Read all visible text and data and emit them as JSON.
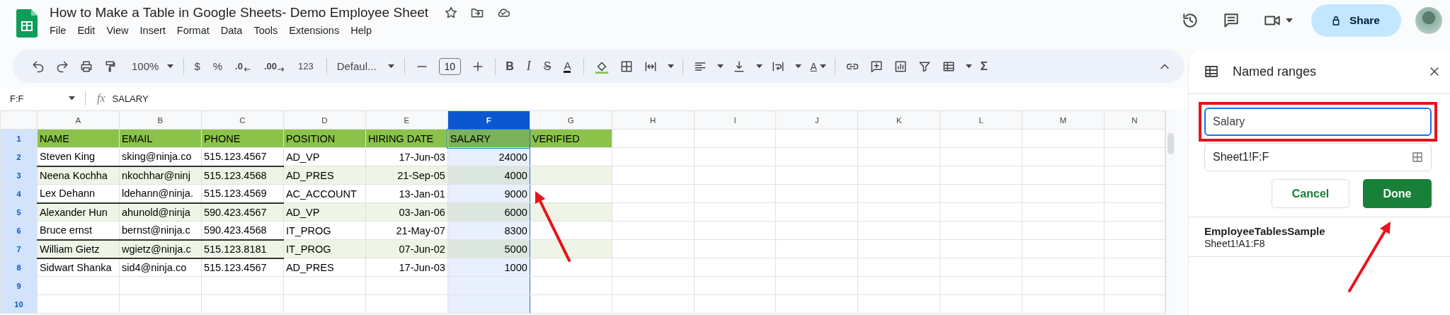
{
  "document": {
    "title": "How to Make a Table in Google Sheets- Demo Employee Sheet"
  },
  "menu": [
    "File",
    "Edit",
    "View",
    "Insert",
    "Format",
    "Data",
    "Tools",
    "Extensions",
    "Help"
  ],
  "share_button": "Share",
  "toolbar": {
    "zoom": "100%",
    "currency": "$",
    "percent": "%",
    "decimal_decrease": ".0",
    "decimal_increase": ".00",
    "number_format": "123",
    "font": "Defaul...",
    "font_size": "10",
    "bold": "B",
    "italic": "I",
    "strikethrough": "S",
    "text_color": "A",
    "text_rotation": "A",
    "functions": "Σ"
  },
  "formula_bar": {
    "cell_ref": "F:F",
    "fx": "fx",
    "content": "SALARY"
  },
  "sheet": {
    "columns": [
      {
        "label": "A",
        "selected": false
      },
      {
        "label": "B",
        "selected": false
      },
      {
        "label": "C",
        "selected": false
      },
      {
        "label": "D",
        "selected": false
      },
      {
        "label": "E",
        "selected": false
      },
      {
        "label": "F",
        "selected": true
      },
      {
        "label": "G",
        "selected": false
      },
      {
        "label": "H",
        "selected": false
      },
      {
        "label": "I",
        "selected": false
      },
      {
        "label": "J",
        "selected": false
      },
      {
        "label": "K",
        "selected": false
      },
      {
        "label": "L",
        "selected": false
      },
      {
        "label": "M",
        "selected": false
      },
      {
        "label": "N",
        "selected": false
      }
    ],
    "row_numbers": [
      "1",
      "2",
      "3",
      "4",
      "5",
      "6",
      "7",
      "8",
      "9",
      "10"
    ],
    "rows": [
      {
        "kind": "header",
        "banded": false,
        "bottom_border": false,
        "cells": [
          "NAME",
          "EMAIL",
          "PHONE",
          "POSITION",
          "HIRING DATE",
          "SALARY",
          "VERIFIED"
        ]
      },
      {
        "kind": "data",
        "banded": false,
        "bottom_border": true,
        "cells": [
          "Steven King",
          "sking@ninja.co",
          "515.123.4567",
          "AD_VP",
          "17-Jun-03",
          "24000"
        ]
      },
      {
        "kind": "data",
        "banded": true,
        "bottom_border": false,
        "cells": [
          "Neena Kochha",
          "nkochhar@ninj",
          "515.123.4568",
          "AD_PRES",
          "21-Sep-05",
          "4000"
        ]
      },
      {
        "kind": "data",
        "banded": false,
        "bottom_border": true,
        "cells": [
          "Lex Dehann",
          "ldehann@ninja.",
          "515.123.4569",
          "AC_ACCOUNT",
          "13-Jan-01",
          "9000"
        ]
      },
      {
        "kind": "data",
        "banded": true,
        "bottom_border": false,
        "cells": [
          "Alexander Hun",
          "ahunold@ninja",
          "590.423.4567",
          "AD_VP",
          "03-Jan-06",
          "6000"
        ]
      },
      {
        "kind": "data",
        "banded": false,
        "bottom_border": true,
        "cells": [
          "Bruce ernst",
          "bernst@ninja.c",
          "590.423.4568",
          "IT_PROG",
          "21-May-07",
          "8300"
        ]
      },
      {
        "kind": "data",
        "banded": true,
        "bottom_border": true,
        "cells": [
          "William Gietz",
          "wgietz@ninja.c",
          "515.123.8181",
          "IT_PROG",
          "07-Jun-02",
          "5000"
        ]
      },
      {
        "kind": "data",
        "banded": false,
        "bottom_border": false,
        "cells": [
          "Sidwart Shanka",
          "sid4@ninja.co",
          "515.123.4567",
          "AD_PRES",
          "17-Jun-03",
          "1000"
        ]
      }
    ]
  },
  "named_ranges_panel": {
    "title": "Named ranges",
    "name_field": {
      "value": "Salary"
    },
    "range_field": {
      "value": "Sheet1!F:F"
    },
    "buttons": [
      {
        "label": "Cancel",
        "kind": "secondary"
      },
      {
        "label": "Done",
        "kind": "primary"
      }
    ],
    "ranges": [
      {
        "name": "EmployeeTablesSample",
        "range": "Sheet1!A1:F8"
      }
    ]
  }
}
